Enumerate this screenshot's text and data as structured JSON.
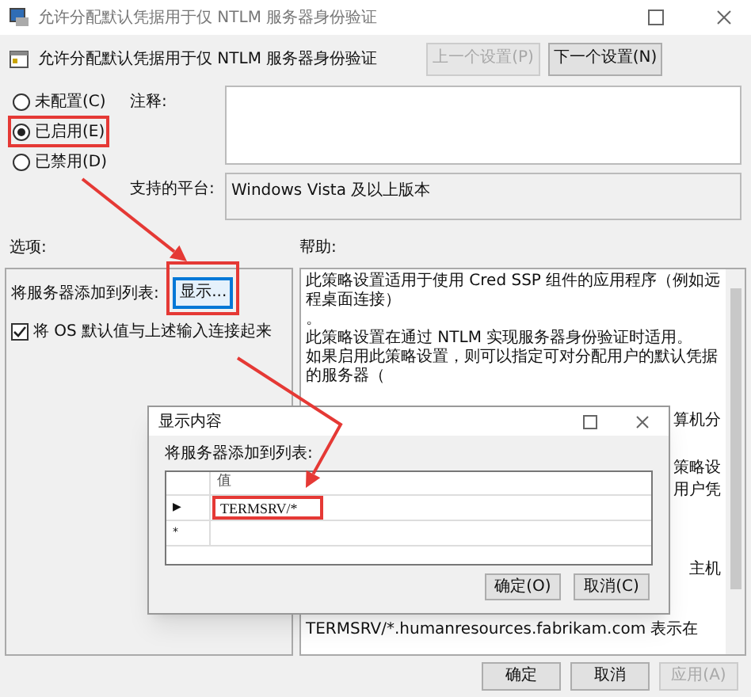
{
  "window": {
    "title": "允许分配默认凭据用于仅 NTLM 服务器身份验证"
  },
  "header": {
    "title": "允许分配默认凭据用于仅 NTLM 服务器身份验证",
    "buttons": [
      {
        "label": "上一个设置(P)",
        "disabled": true
      },
      {
        "label": "下一个设置(N)",
        "disabled": false
      }
    ]
  },
  "state_options": [
    {
      "label": "未配置(C)",
      "selected": false
    },
    {
      "label": "已启用(E)",
      "selected": true
    },
    {
      "label": "已禁用(D)",
      "selected": false
    }
  ],
  "comment": {
    "label": "注释:"
  },
  "platform": {
    "label": "支持的平台:",
    "value": "Windows Vista 及以上版本"
  },
  "options": {
    "label": "选项:",
    "list_label": "将服务器添加到列表:",
    "show_button": "显示...",
    "checkbox": {
      "label": "将 OS 默认值与上述输入连接起来",
      "checked": true
    }
  },
  "help": {
    "label": "帮助:",
    "lines": [
      {
        "text": "此策略设置适用于使用 Cred SSP 组件的应用程序（例如远程桌面连接）",
        "kind": "full"
      },
      {
        "text": "。",
        "kind": "full"
      },
      {
        "text": "此策略设置在通过 NTLM 实现服务器身份验证时适用。",
        "kind": "full"
      },
      {
        "text": "如果启用此策略设置，则可以指定可对分配用户的默认凭据的服务器（",
        "kind": "full"
      },
      {
        "text": "算机分",
        "kind": "fragment"
      },
      {
        "text": "策略设",
        "kind": "fragment"
      },
      {
        "text": "用户凭",
        "kind": "fragment"
      },
      {
        "text": "主机",
        "kind": "fragment"
      },
      {
        "text": "TERMSRV/*.humanresources.fabrikam.com 表示在",
        "kind": "full"
      }
    ]
  },
  "footer_buttons": [
    {
      "label": "确定",
      "disabled": false
    },
    {
      "label": "取消",
      "disabled": false
    },
    {
      "label": "应用(A)",
      "disabled": true
    }
  ],
  "dialog": {
    "title": "显示内容",
    "list_label": "将服务器添加到列表:",
    "column": "值",
    "rows": [
      {
        "marker": "▶",
        "value": "TERMSRV/*"
      },
      {
        "marker": "*"
      }
    ],
    "buttons": [
      {
        "label": "确定(O)"
      },
      {
        "label": "取消(C)"
      }
    ]
  }
}
